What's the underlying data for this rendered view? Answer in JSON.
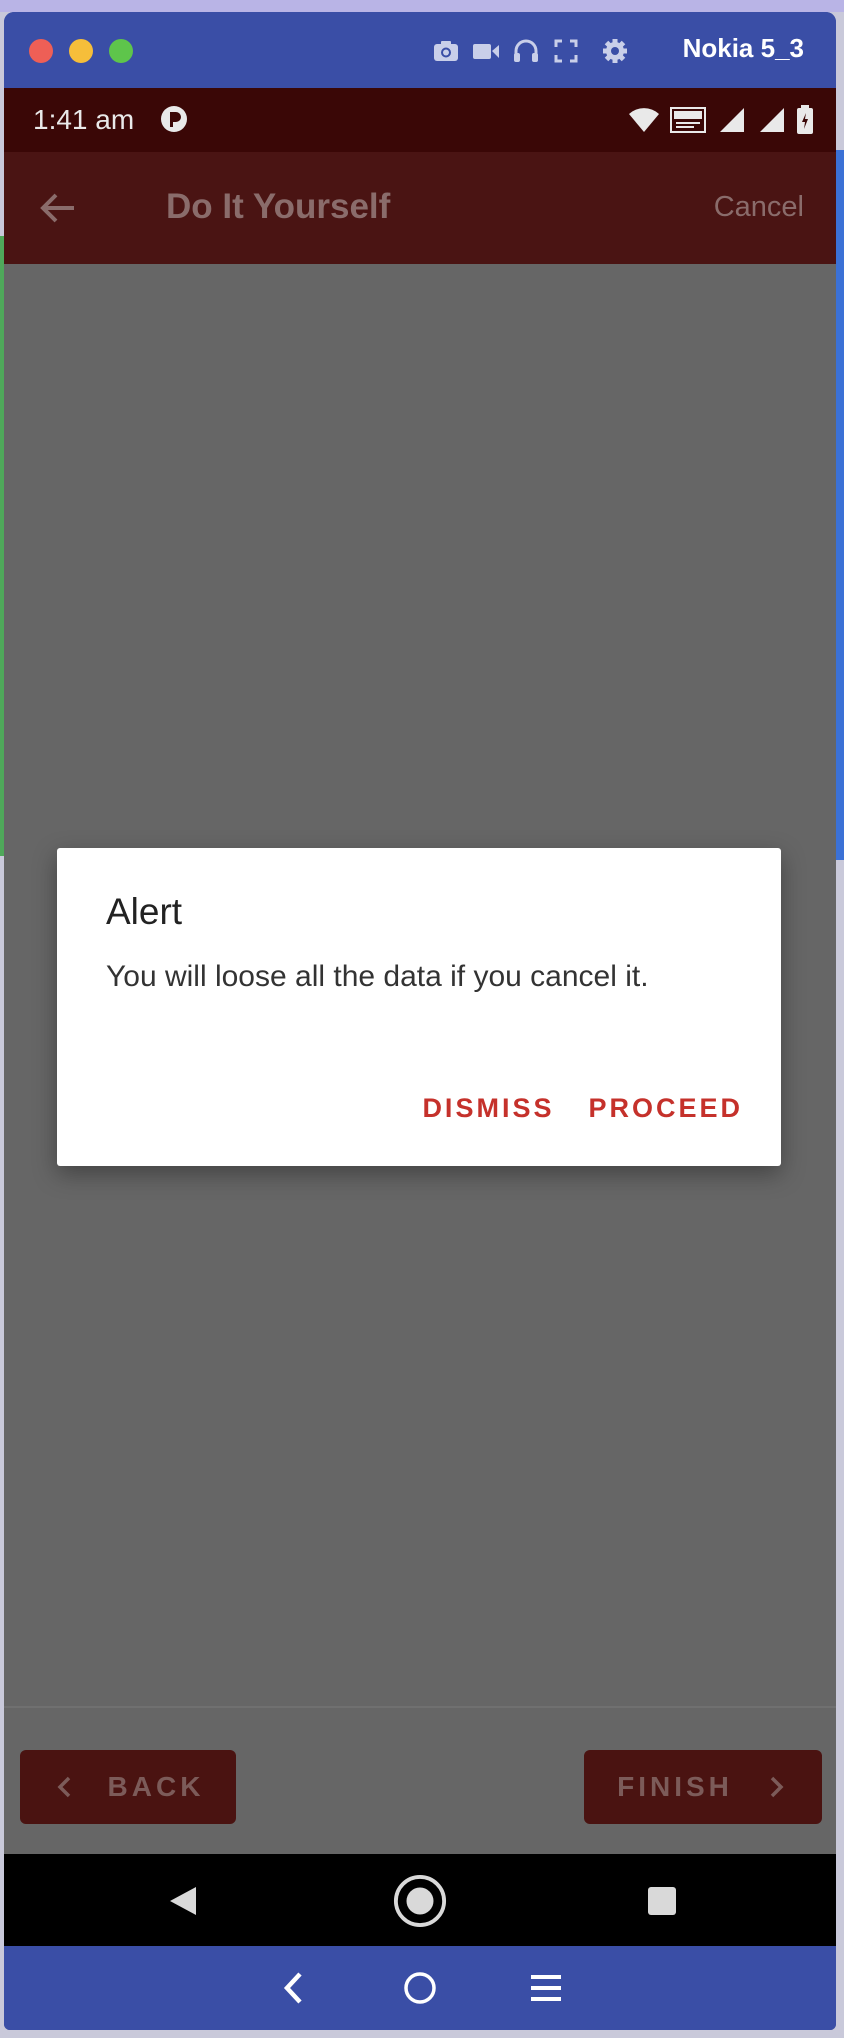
{
  "window": {
    "device_name": "Nokia 5_3",
    "toolbar_icons": [
      "camera-icon",
      "video-icon",
      "headphones-icon",
      "fullscreen-icon",
      "gear-icon"
    ]
  },
  "status_bar": {
    "time": "1:41 am",
    "icons": [
      "app-notification-icon",
      "wifi-icon",
      "volte-icon",
      "signal-icon",
      "battery-icon"
    ]
  },
  "app_bar": {
    "title": "Do It Yourself",
    "cancel_label": "Cancel",
    "back_icon": "arrow-left-icon"
  },
  "dialog": {
    "title": "Alert",
    "message": "You will loose all the data if you cancel it.",
    "dismiss_label": "DISMISS",
    "proceed_label": "PROCEED",
    "accent_color": "#c5312b"
  },
  "bottom_actions": {
    "back_label": "BACK",
    "finish_label": "FINISH"
  },
  "android_nav": {
    "buttons": [
      "back-triangle-icon",
      "home-circle-icon",
      "recents-square-icon"
    ]
  },
  "simulator_toolbar": {
    "buttons": [
      "chevron-left-icon",
      "circle-icon",
      "menu-icon"
    ]
  },
  "colors": {
    "app_bar": "#4a1413",
    "status_bar": "#3a0706",
    "scrim": "#666666",
    "window": "#3a4ea6"
  }
}
